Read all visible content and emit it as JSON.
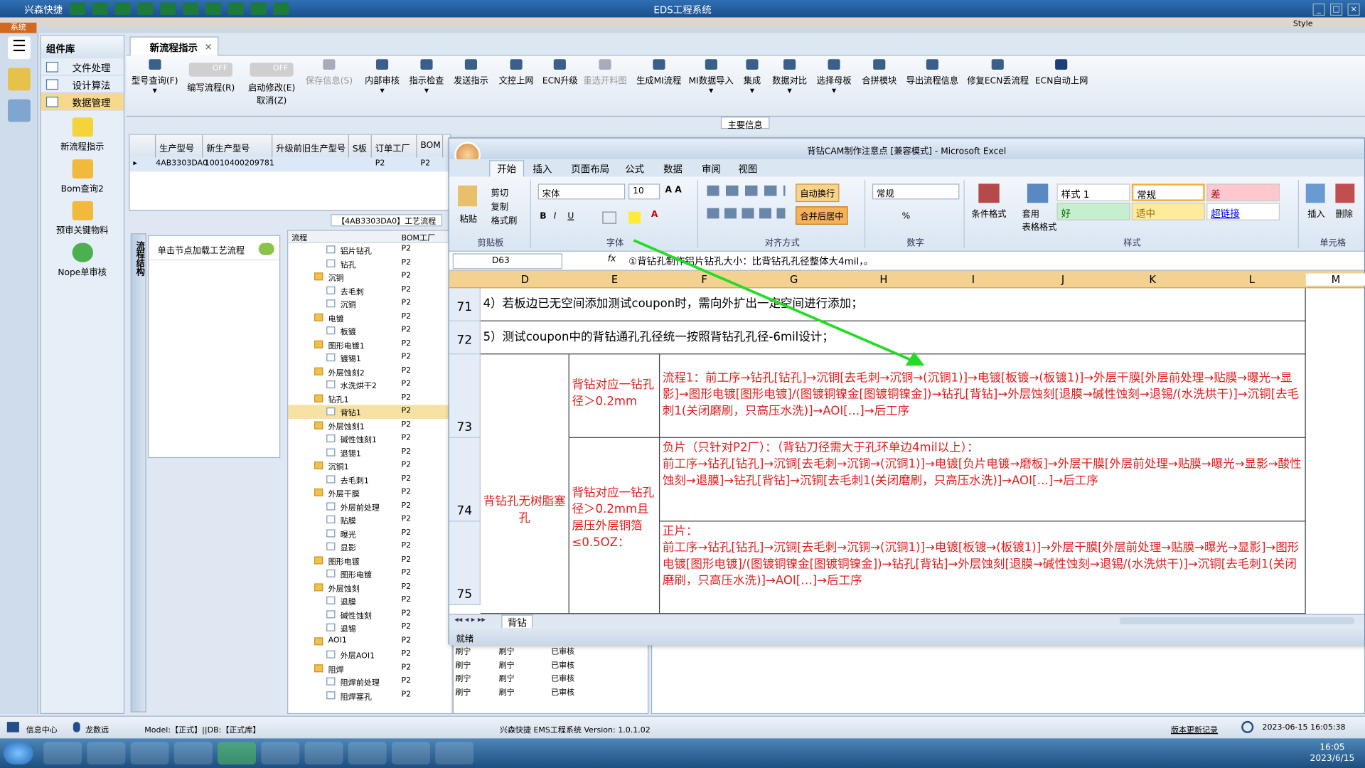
{
  "app": {
    "brand": "兴森快捷",
    "title": "EDS工程系统",
    "systab": "系统",
    "style": "Style"
  },
  "left_menu": {
    "header": "组件库",
    "items": [
      "文件处理",
      "设计算法",
      "数据管理"
    ],
    "subitems": [
      "新流程指示",
      "Bom查询2",
      "预审关键物料",
      "Nope单审核"
    ]
  },
  "doc_tab": {
    "label": "新流程指示",
    "close": "×"
  },
  "ribbon": {
    "buttons": [
      "型号查询(F)",
      "编写流程(R)",
      "启动修改(E)",
      "保存信息(S)",
      "内部审核",
      "指示检查",
      "发送指示",
      "文控上网",
      "ECN升级",
      "重选开料图",
      "生成MI流程",
      "MI数据导入",
      "集成",
      "数据对比",
      "选择母板",
      "合拼模块",
      "导出流程信息",
      "修复ECN丢流程",
      "ECN自动上网"
    ],
    "sublabel": "取消(Z)",
    "toggle": "OFF",
    "section": "主要信息"
  },
  "grid": {
    "headers": [
      "生产型号",
      "新生产型号",
      "升级前旧生产型号",
      "S板",
      "订单工厂",
      "BOM"
    ],
    "row": [
      "4AB3303DA0",
      "10010400209781",
      "",
      "P2",
      "P2"
    ]
  },
  "lower_tab": "【4AB3303DA0】工艺流程",
  "vtab": "流程结构",
  "process_hint": "单击节点加载工艺流程",
  "tree": {
    "headers": [
      "流程",
      "BOM工厂"
    ],
    "rows": [
      {
        "n": "铝片钻孔",
        "lvl": 2,
        "f": false,
        "c": "P2"
      },
      {
        "n": "钻孔",
        "lvl": 2,
        "f": false,
        "c": "P2"
      },
      {
        "n": "沉铜",
        "lvl": 1,
        "f": true,
        "c": "P2"
      },
      {
        "n": "去毛刺",
        "lvl": 2,
        "f": false,
        "c": "P2"
      },
      {
        "n": "沉铜",
        "lvl": 2,
        "f": false,
        "c": "P2"
      },
      {
        "n": "电镀",
        "lvl": 1,
        "f": true,
        "c": "P2"
      },
      {
        "n": "板镀",
        "lvl": 2,
        "f": false,
        "c": "P2"
      },
      {
        "n": "图形电镀1",
        "lvl": 1,
        "f": true,
        "c": "P2"
      },
      {
        "n": "镀锡1",
        "lvl": 2,
        "f": false,
        "c": "P2"
      },
      {
        "n": "外层蚀刻2",
        "lvl": 1,
        "f": true,
        "c": "P2"
      },
      {
        "n": "水洗烘干2",
        "lvl": 2,
        "f": false,
        "c": "P2"
      },
      {
        "n": "钻孔1",
        "lvl": 1,
        "f": true,
        "c": "P2"
      },
      {
        "n": "背钻1",
        "lvl": 2,
        "f": false,
        "c": "P2",
        "sel": true
      },
      {
        "n": "外层蚀刻1",
        "lvl": 1,
        "f": true,
        "c": "P2"
      },
      {
        "n": "碱性蚀刻1",
        "lvl": 2,
        "f": false,
        "c": "P2"
      },
      {
        "n": "退锡1",
        "lvl": 2,
        "f": false,
        "c": "P2"
      },
      {
        "n": "沉铜1",
        "lvl": 1,
        "f": true,
        "c": "P2"
      },
      {
        "n": "去毛刺1",
        "lvl": 2,
        "f": false,
        "c": "P2"
      },
      {
        "n": "外层干膜",
        "lvl": 1,
        "f": true,
        "c": "P2"
      },
      {
        "n": "外层前处理",
        "lvl": 2,
        "f": false,
        "c": "P2"
      },
      {
        "n": "贴膜",
        "lvl": 2,
        "f": false,
        "c": "P2"
      },
      {
        "n": "曝光",
        "lvl": 2,
        "f": false,
        "c": "P2"
      },
      {
        "n": "显影",
        "lvl": 2,
        "f": false,
        "c": "P2"
      },
      {
        "n": "图形电镀",
        "lvl": 1,
        "f": true,
        "c": "P2"
      },
      {
        "n": "图形电镀",
        "lvl": 2,
        "f": false,
        "c": "P2"
      },
      {
        "n": "外层蚀刻",
        "lvl": 1,
        "f": true,
        "c": "P2"
      },
      {
        "n": "退膜",
        "lvl": 2,
        "f": false,
        "c": "P2"
      },
      {
        "n": "碱性蚀刻",
        "lvl": 2,
        "f": false,
        "c": "P2"
      },
      {
        "n": "退锡",
        "lvl": 2,
        "f": false,
        "c": "P2"
      },
      {
        "n": "AOI1",
        "lvl": 1,
        "f": true,
        "c": "P2"
      },
      {
        "n": "外层AOI1",
        "lvl": 2,
        "f": false,
        "c": "P2"
      },
      {
        "n": "阻焊",
        "lvl": 1,
        "f": true,
        "c": "P2"
      },
      {
        "n": "阻焊前处理",
        "lvl": 2,
        "f": false,
        "c": "P2"
      },
      {
        "n": "阻焊塞孔",
        "lvl": 2,
        "f": false,
        "c": "P2"
      }
    ]
  },
  "bottom_rows": [
    [
      "刷宁",
      "刷宁",
      "已审核"
    ],
    [
      "刷宁",
      "刷宁",
      "已审核"
    ],
    [
      "刷宁",
      "刷宁",
      "已审核"
    ],
    [
      "刷宁",
      "刷宁",
      "已审核"
    ]
  ],
  "status": {
    "info": "信息中心",
    "user": "龙数远",
    "model": "Model:【正式】||DB:【正式库】",
    "version": "兴森快捷 EMS工程系统 Version: 1.0.1.02",
    "log": "版本更新记录",
    "time": "2023-06-15 16:05:38"
  },
  "taskbar": {
    "clock_time": "16:05",
    "clock_date": "2023/6/15"
  },
  "excel": {
    "title": "背钻CAM制作注意点 [兼容模式] - Microsoft Excel",
    "tabs": [
      "开始",
      "插入",
      "页面布局",
      "公式",
      "数据",
      "审阅",
      "视图"
    ],
    "clipboard": {
      "cut": "剪切",
      "copy": "复制",
      "paint": "格式刷",
      "paste": "粘贴",
      "label": "剪贴板"
    },
    "font": {
      "name": "宋体",
      "size": "10",
      "label": "字体"
    },
    "align": {
      "wrap": "自动换行",
      "merge": "合并后居中",
      "label": "对齐方式"
    },
    "number": {
      "fmt": "常规",
      "label": "数字",
      "pct": "%"
    },
    "styles": {
      "cond": "条件格式",
      "table": "套用\n表格格式",
      "cells": [
        "样式 1",
        "常规",
        "差",
        "好",
        "适中",
        "超链接"
      ],
      "label": "样式"
    },
    "cellsgrp": {
      "insert": "插入",
      "delete": "删除",
      "label": "单元格"
    },
    "namebox": "D63",
    "formula": "①背钻孔制作铝片钻孔大小：比背钻孔孔径整体大4mil，。",
    "cols": [
      "D",
      "E",
      "F",
      "G",
      "H",
      "I",
      "J",
      "K",
      "L",
      "M"
    ],
    "rows": [
      "71",
      "72",
      "73",
      "74",
      "75"
    ],
    "r71": "4）若板边已无空间添加测试coupon时，需向外扩出一定空间进行添加；",
    "r72": "5）测试coupon中的背钻通孔孔径统一按照背钻孔孔径-6mil设计；",
    "d_merge": "背钻孔无树脂塞孔",
    "e73": "背钻对应一钻孔径＞0.2mm",
    "e74": "背钻对应一钻孔径＞0.2mm且层压外层铜箔≤0.5OZ：",
    "f73": "流程1：前工序→钻孔[钻孔]→沉铜[去毛刺→沉铜→(沉铜1)]→电镀[板镀→(板镀1)]→外层干膜[外层前处理→贴膜→曝光→显影]→图形电镀[图形电镀]/(图镀铜镍金[图镀铜镍金])→钻孔[背钻]→外层蚀刻[退膜→碱性蚀刻→退锡/(水洗烘干)]→沉铜[去毛刺1(关闭磨刷，只高压水洗)]→AOI[…]→后工序",
    "f74": "负片（只针对P2厂）：（背钻刀径需大于孔环单边4mil以上）：\n前工序→钻孔[钻孔]→沉铜[去毛刺→沉铜→(沉铜1)]→电镀[负片电镀→磨板]→外层干膜[外层前处理→贴膜→曝光→显影→酸性蚀刻→退膜]→钻孔[背钻]→沉铜[去毛刺1(关闭磨刷，只高压水洗)]→AOI[…]→后工序",
    "f75": "正片：\n前工序→钻孔[钻孔]→沉铜[去毛刺→沉铜→(沉铜1)]→电镀[板镀→(板镀1)]→外层干膜[外层前处理→贴膜→曝光→显影]→图形电镀[图形电镀]/(图镀铜镍金[图镀铜镍金])→钻孔[背钻]→外层蚀刻[退膜→碱性蚀刻→退锡/(水洗烘干)]→沉铜[去毛刺1(关闭磨刷，只高压水洗)]→AOI[…]→后工序",
    "sheet": "背钻",
    "status": "就绪"
  },
  "colors": {
    "accent": "#f3d191",
    "red_text": "#e21d1d",
    "arrow": "#22dd22"
  }
}
